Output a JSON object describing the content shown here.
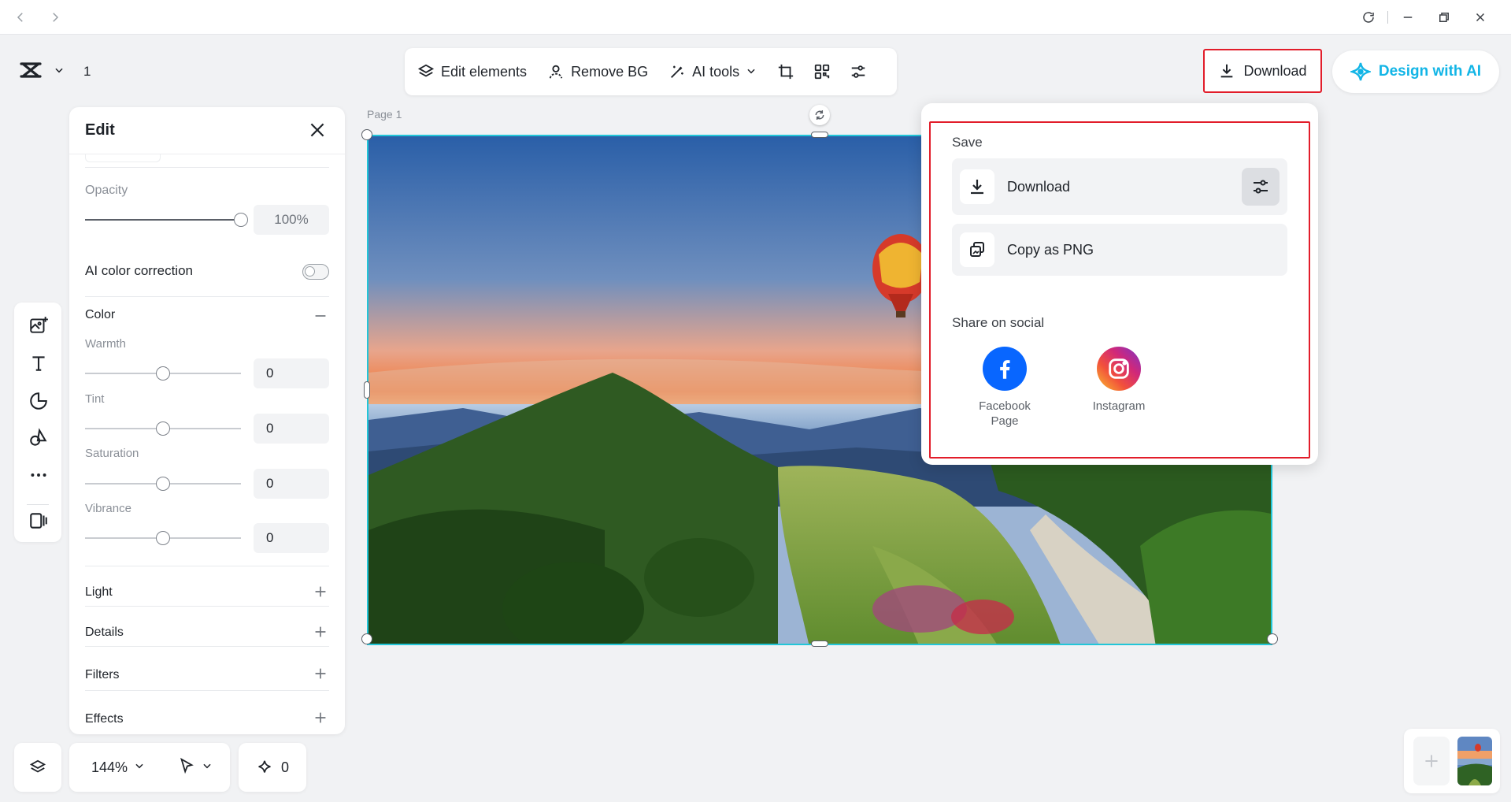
{
  "header": {
    "project_number": "1"
  },
  "toolbar": {
    "edit_elements": "Edit elements",
    "remove_bg": "Remove BG",
    "ai_tools": "AI tools"
  },
  "top_right": {
    "download": "Download",
    "design_with_ai": "Design with AI"
  },
  "edit_panel": {
    "title": "Edit",
    "opacity": {
      "label": "Opacity",
      "value": "100%",
      "level": 1.0
    },
    "ai_color_correction": {
      "label": "AI color correction",
      "enabled": false
    },
    "color": {
      "label": "Color",
      "sliders": [
        {
          "label": "Warmth",
          "value": "0",
          "level": 0.5
        },
        {
          "label": "Tint",
          "value": "0",
          "level": 0.5
        },
        {
          "label": "Saturation",
          "value": "0",
          "level": 0.5
        },
        {
          "label": "Vibrance",
          "value": "0",
          "level": 0.5
        }
      ]
    },
    "sections": [
      "Light",
      "Details",
      "Filters",
      "Effects"
    ]
  },
  "canvas": {
    "page_label": "Page 1"
  },
  "download_popup": {
    "save_label": "Save",
    "download": "Download",
    "copy_png": "Copy as PNG",
    "share_label": "Share on social",
    "facebook": "Facebook Page",
    "instagram": "Instagram"
  },
  "bottom_bar": {
    "zoom": "144%",
    "ai_count": "0"
  },
  "colors": {
    "accent": "#12b5e6",
    "highlight_red": "#e21d2a",
    "selection": "#22c6d8",
    "facebook": "#0866ff"
  }
}
